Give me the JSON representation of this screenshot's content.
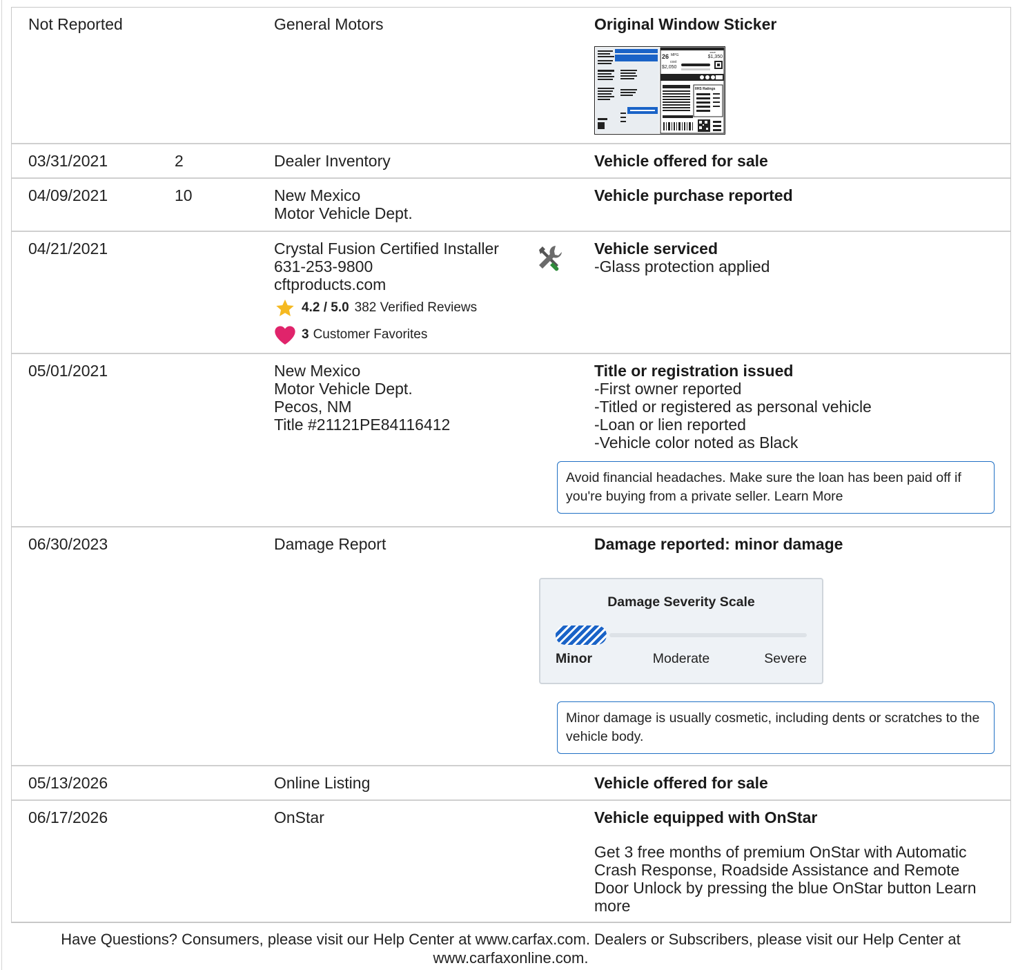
{
  "rows": [
    {
      "date": "Not Reported",
      "odometer": "",
      "source": [
        "General Motors"
      ],
      "description_title": "Original Window Sticker",
      "sticker": {
        "mpg": "26",
        "mpg_unit": "MPG",
        "save": "save",
        "save_amount": "$1,350",
        "cost_label": "cost",
        "cost_amount": "$2,050",
        "ihs_label": "IIHS Ratings"
      }
    },
    {
      "date": "03/31/2021",
      "odometer": "2",
      "source": [
        "Dealer Inventory"
      ],
      "description_title": "Vehicle offered for sale"
    },
    {
      "date": "04/09/2021",
      "odometer": "10",
      "source": [
        "New Mexico",
        "Motor Vehicle Dept."
      ],
      "description_title": "Vehicle purchase reported"
    },
    {
      "date": "04/21/2021",
      "odometer": "",
      "source": [
        "Crystal Fusion Certified Installer",
        "631-253-9800",
        "cftproducts.com"
      ],
      "rating": {
        "score": "4.2 / 5.0",
        "reviews": "382 Verified Reviews"
      },
      "favorites": {
        "count": "3",
        "label": "Customer Favorites"
      },
      "icon": "service-tools-icon",
      "description_title": "Vehicle serviced",
      "details": [
        "Glass protection applied"
      ]
    },
    {
      "date": "05/01/2021",
      "odometer": "",
      "source": [
        "New Mexico",
        "Motor Vehicle Dept.",
        "Pecos, NM",
        "Title #21121PE84116412"
      ],
      "description_title": "Title or registration issued",
      "details": [
        "First owner reported",
        "Titled or registered as personal vehicle",
        "Loan or lien reported",
        "Vehicle color noted as Black"
      ],
      "tip": "Avoid financial headaches. Make sure the loan has been paid off if you're buying from a private seller. Learn More"
    },
    {
      "date": "06/30/2023",
      "odometer": "",
      "source": [
        "Damage Report"
      ],
      "description_title": "Damage reported: minor damage",
      "severity": {
        "title": "Damage Severity Scale",
        "levels": [
          "Minor",
          "Moderate",
          "Severe"
        ],
        "selected": "Minor",
        "fill_fraction": 0.2
      },
      "tip": "Minor damage is usually cosmetic, including dents or scratches to the vehicle body."
    },
    {
      "date": "05/13/2026",
      "odometer": "",
      "source": [
        "Online Listing"
      ],
      "description_title": "Vehicle offered for sale"
    },
    {
      "date": "06/17/2026",
      "odometer": "",
      "source": [
        "OnStar"
      ],
      "description_title": "Vehicle equipped with OnStar",
      "paragraph": "Get 3 free months of premium OnStar with Automatic Crash Response, Roadside Assistance and Remote Door Unlock by pressing the blue OnStar button Learn more"
    }
  ],
  "footer": "Have Questions? Consumers, please visit our Help Center at www.carfax.com. Dealers or Subscribers, please visit our Help Center at www.carfaxonline.com.",
  "colors": {
    "accent_blue": "#1a63c7",
    "star_gold": "#f5b921",
    "heart_pink": "#e0246b",
    "tool_green": "#2e8b3a"
  }
}
